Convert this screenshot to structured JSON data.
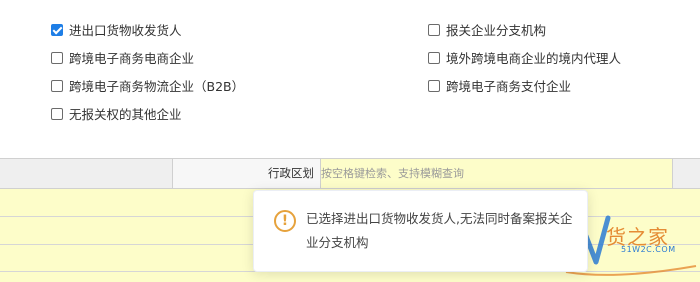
{
  "checkboxes": [
    {
      "label": "进出口货物收发货人",
      "checked": true
    },
    {
      "label": "跨境电子商务电商企业",
      "checked": false
    },
    {
      "label": "跨境电子商务物流企业（B2B）",
      "checked": false
    },
    {
      "label": "无报关权的其他企业",
      "checked": false
    },
    {
      "label": "报关企业分支机构",
      "checked": false
    },
    {
      "label": "境外跨境电商企业的境内代理人",
      "checked": false
    },
    {
      "label": "跨境电子商务支付企业",
      "checked": false
    }
  ],
  "form": {
    "region_label": "行政区划",
    "region_placeholder": "按空格键检索、支持模糊查询"
  },
  "toast": {
    "icon": "warning-icon",
    "message": "已选择进出口货物收发货人,无法同时备案报关企业分支机构",
    "accent": "#e6a23c"
  },
  "watermark": {
    "brand": "货之家",
    "url": "51W2C.COM"
  },
  "colors": {
    "checkbox_checked": "#1e7ee6",
    "input_background": "#fdfdc9"
  }
}
